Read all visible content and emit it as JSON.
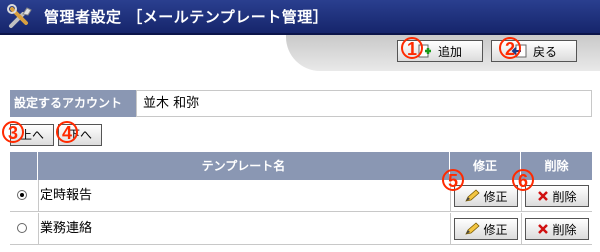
{
  "title": "管理者設定 ［メールテンプレート管理］",
  "toolbar": {
    "add_label": "追加",
    "back_label": "戻る"
  },
  "account": {
    "label": "設定するアカウント",
    "value": "並木 和弥"
  },
  "move": {
    "up_label": "上へ",
    "down_label": "下へ"
  },
  "table": {
    "headers": {
      "name": "テンプレート名",
      "edit": "修正",
      "delete": "削除"
    },
    "rows": [
      {
        "name": "定時報告",
        "selected": true,
        "edit_label": "修正",
        "delete_label": "削除"
      },
      {
        "name": "業務連絡",
        "selected": false,
        "edit_label": "修正",
        "delete_label": "削除"
      }
    ]
  },
  "annotations": [
    "1",
    "2",
    "3",
    "4",
    "5",
    "6"
  ],
  "colors": {
    "titlebar": "#1e2f7a",
    "header_bg": "#8a97b3",
    "annotation": "#ff2a00"
  }
}
